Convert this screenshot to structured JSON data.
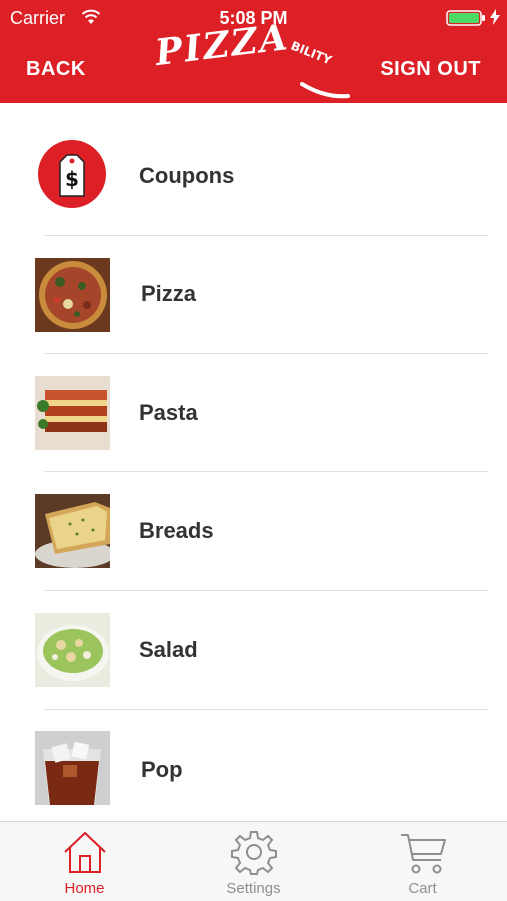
{
  "status_bar": {
    "carrier": "Carrier",
    "time": "5:08 PM",
    "icons": [
      "wifi-icon",
      "battery-icon",
      "charging-icon"
    ]
  },
  "header": {
    "back_label": "BACK",
    "signout_label": "SIGN OUT",
    "logo_text": "PIZZA",
    "logo_suffix": "BILITY",
    "background_color": "#dd1f26"
  },
  "menu": {
    "items": [
      {
        "label": "Coupons",
        "icon": "coupon-tag-icon"
      },
      {
        "label": "Pizza",
        "icon": "pizza-image"
      },
      {
        "label": "Pasta",
        "icon": "pasta-image"
      },
      {
        "label": "Breads",
        "icon": "bread-image"
      },
      {
        "label": "Salad",
        "icon": "salad-image"
      },
      {
        "label": "Pop",
        "icon": "pop-image"
      }
    ]
  },
  "tabbar": {
    "tabs": [
      {
        "label": "Home",
        "icon": "home-icon",
        "active": true
      },
      {
        "label": "Settings",
        "icon": "gear-icon",
        "active": false
      },
      {
        "label": "Cart",
        "icon": "cart-icon",
        "active": false
      }
    ],
    "active_color": "#dd1f26",
    "inactive_color": "#8e8e93"
  }
}
